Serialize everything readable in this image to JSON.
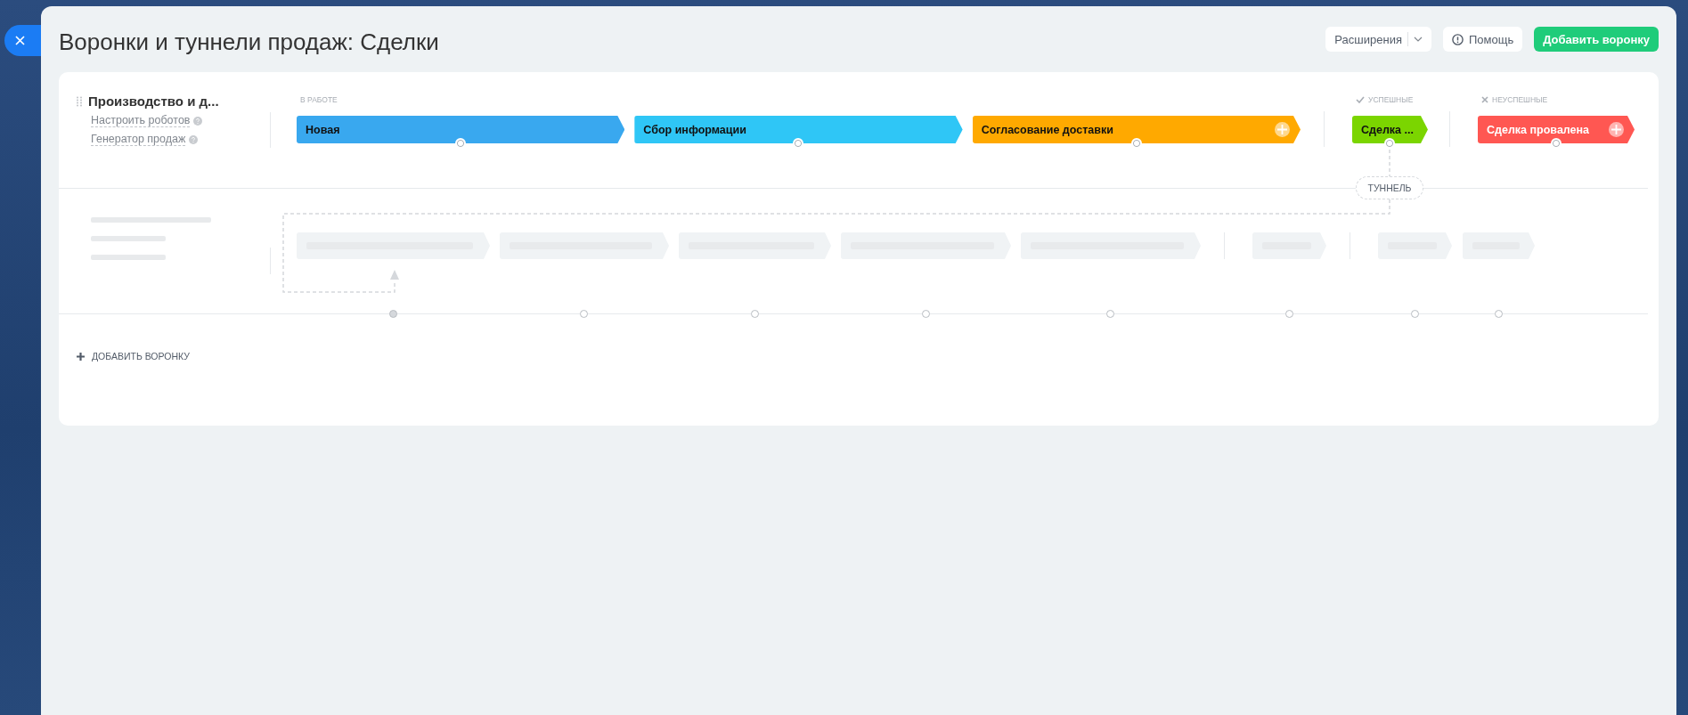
{
  "title": "Воронки и туннели продаж: Сделки",
  "header_buttons": [
    {
      "kind": "dropdown",
      "label": "Расширения"
    },
    {
      "kind": "help",
      "label": "Помощь"
    },
    {
      "kind": "primary",
      "label": "Добавить воронку"
    }
  ],
  "pipelines": [
    {
      "name": "Производство и д...",
      "links": [
        "Настроить роботов",
        "Генератор продаж"
      ],
      "groups": [
        {
          "kind": "in_progress",
          "label": "В РАБОТЕ",
          "stages": [
            {
              "name": "Новая",
              "color": "#39a8ef",
              "add_button": false
            },
            {
              "name": "Сбор информации",
              "color": "#2fc6f6",
              "add_button": false
            },
            {
              "name": "Согласование доставки",
              "color": "#ffa900",
              "add_button": true
            }
          ]
        },
        {
          "kind": "success",
          "label": "УСПЕШНЫЕ",
          "stages": [
            {
              "name": "Сделка ...",
              "color": "#7bd500",
              "add_button": false
            }
          ]
        },
        {
          "kind": "failure",
          "label": "НЕУСПЕШНЫЕ",
          "stages": [
            {
              "name": "Сделка провалена",
              "color": "#ff5752",
              "add_button": true
            }
          ]
        }
      ]
    }
  ],
  "tunnel_label": "ТУННЕЛЬ",
  "add_funnel": "ДОБАВИТЬ ВОРОНКУ"
}
